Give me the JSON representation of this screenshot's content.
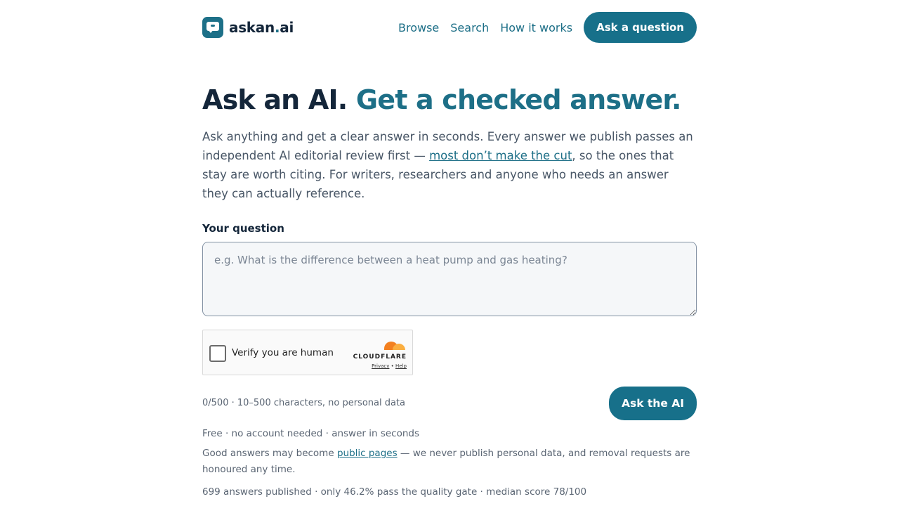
{
  "brand": {
    "name_main": "askan",
    "name_dot": ".",
    "name_suffix": "ai"
  },
  "nav": {
    "browse": "Browse",
    "search": "Search",
    "how": "How it works",
    "ask_button": "Ask a question"
  },
  "hero": {
    "title_dark": "Ask an AI.",
    "title_accent": "Get a checked answer.",
    "intro_before": "Ask anything and get a clear answer in seconds. Every answer we publish passes an independent AI editorial review first — ",
    "intro_link": "most don’t make the cut",
    "intro_after": ", so the ones that stay are worth citing. For writers, researchers and anyone who needs an answer they can actually reference."
  },
  "form": {
    "label": "Your question",
    "placeholder": "e.g. What is the difference between a heat pump and gas heating?",
    "char_hint": "0/500 · 10–500 characters, no personal data",
    "submit": "Ask the AI"
  },
  "captcha": {
    "label": "Verify you are human",
    "brand": "CLOUDFLARE",
    "privacy": "Privacy",
    "sep": " • ",
    "help": "Help"
  },
  "footer": {
    "line1": "Free · no account needed · answer in seconds",
    "line2_before": "Good answers may become ",
    "line2_link": "public pages",
    "line2_after": " — we never publish personal data, and removal requests are honoured any time.",
    "stats": "699 answers published · only 46.2% pass the quality gate · median score 78/100"
  },
  "colors": {
    "accent": "#17708a",
    "heading": "#14263a",
    "text": "#485666"
  }
}
